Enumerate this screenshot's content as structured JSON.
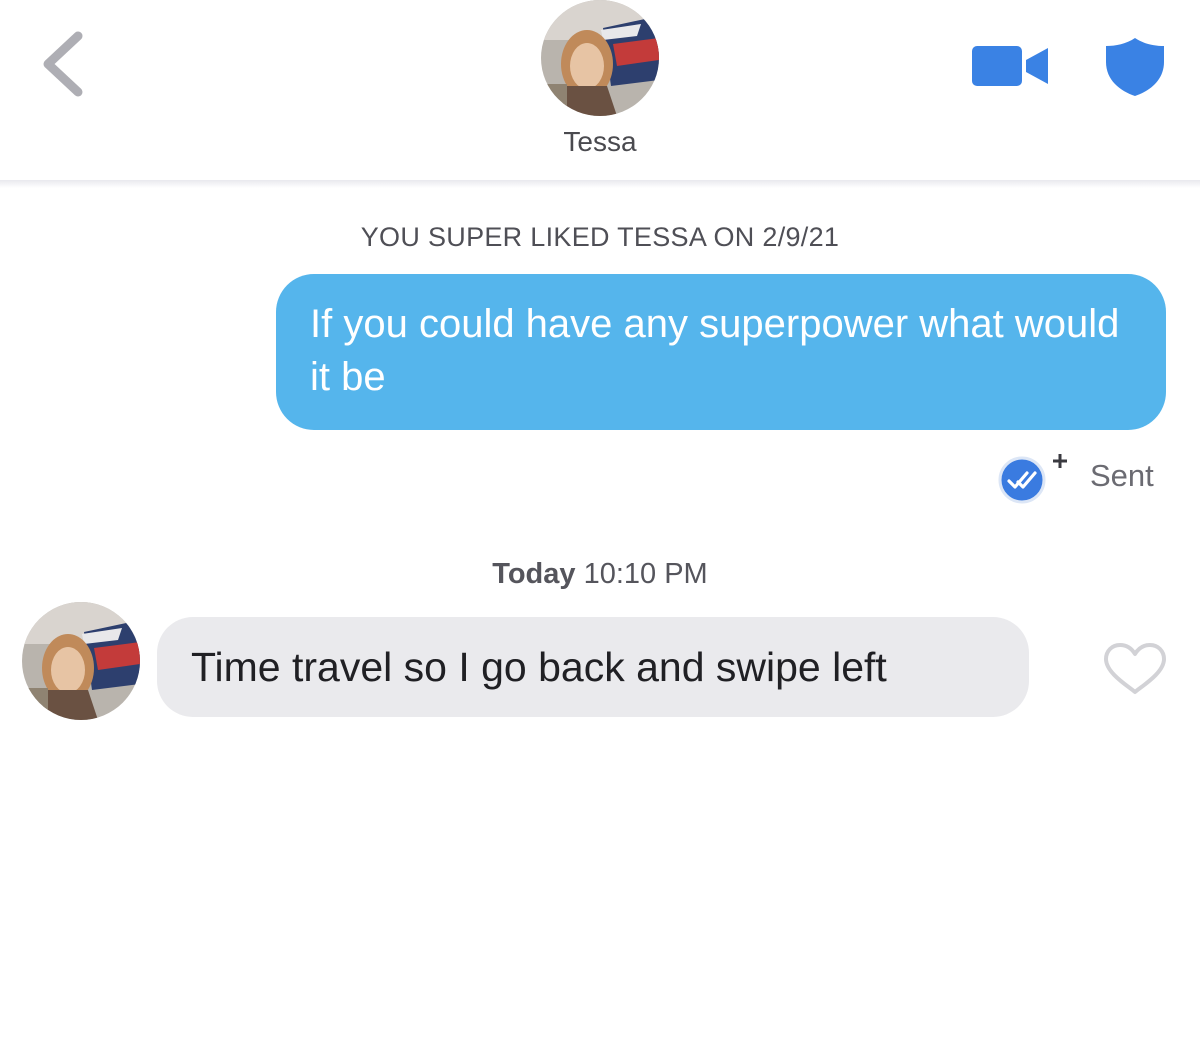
{
  "header": {
    "back_icon": "chevron-left-icon",
    "match_name": "Tessa",
    "avatar_icon": "profile-photo",
    "video_icon": "video-camera-icon",
    "safety_icon": "shield-icon",
    "accent_color": "#3a82e4"
  },
  "conversation": {
    "system_note": "YOU SUPER LIKED TESSA ON 2/9/21",
    "outgoing": {
      "text": "If you could have any superpower what would it be",
      "bubble_color": "#55b5ec",
      "receipt_icon": "double-check-super-like-icon",
      "status": "Sent"
    },
    "timestamp": {
      "day": "Today",
      "time": "10:10 PM"
    },
    "incoming": {
      "text": "Time travel so I go back and swipe left",
      "bubble_color": "#eaeaed",
      "like_icon": "heart-outline-icon"
    }
  }
}
